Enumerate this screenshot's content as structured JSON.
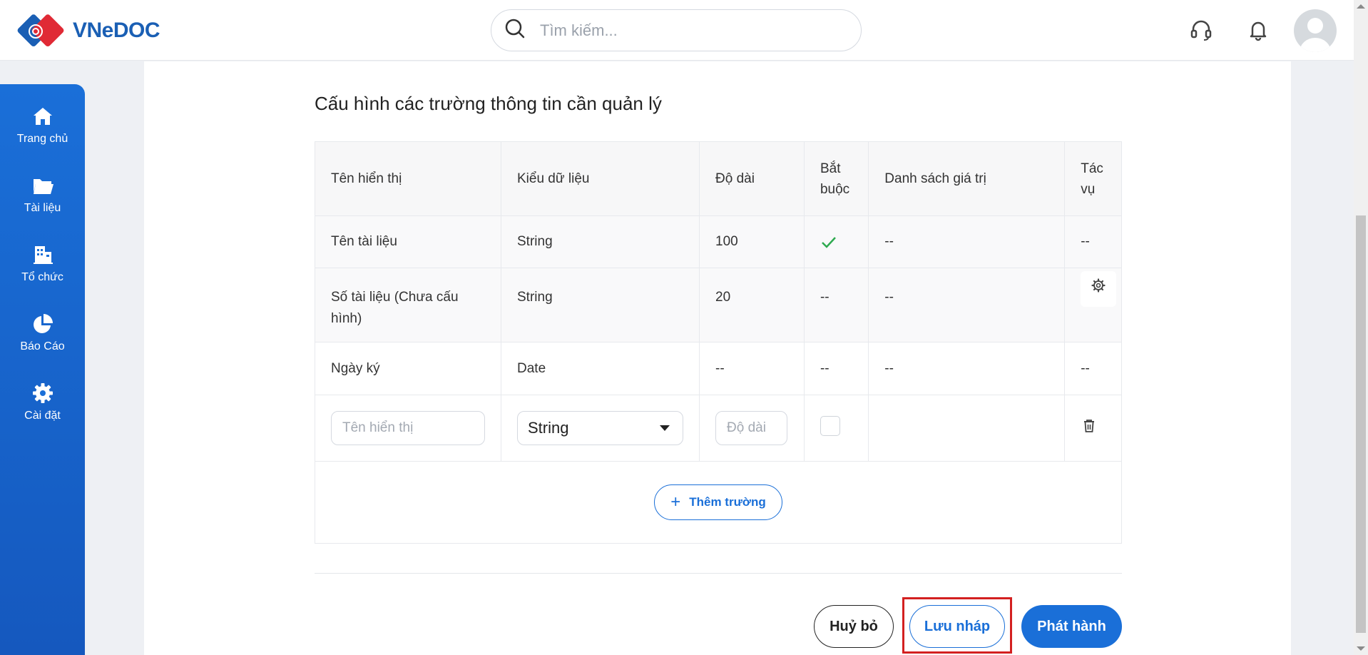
{
  "header": {
    "logo_text": "VNeDOC",
    "search_placeholder": "Tìm kiếm..."
  },
  "sidebar": {
    "items": [
      {
        "label": "Trang chủ",
        "icon": "home-icon"
      },
      {
        "label": "Tài liệu",
        "icon": "folder-icon"
      },
      {
        "label": "Tổ chức",
        "icon": "building-icon"
      },
      {
        "label": "Báo Cáo",
        "icon": "pie-chart-icon"
      },
      {
        "label": "Cài đặt",
        "icon": "gear-icon"
      }
    ]
  },
  "main": {
    "title": "Cấu hình các trường thông tin cần quản lý",
    "columns": [
      "Tên hiển thị",
      "Kiểu dữ liệu",
      "Độ dài",
      "Bắt buộc",
      "Danh sách giá trị",
      "Tác vụ"
    ],
    "rows": [
      {
        "name": "Tên tài liệu",
        "type": "String",
        "length": "100",
        "required": "check-icon",
        "values": "--",
        "action": "--"
      },
      {
        "name": "Số tài liệu (Chưa cấu hình)",
        "type": "String",
        "length": "20",
        "required": "--",
        "values": "--",
        "action": "gear-icon"
      },
      {
        "name": "Ngày ký",
        "type": "Date",
        "length": "--",
        "required": "--",
        "values": "--",
        "action": "--"
      }
    ],
    "new_row": {
      "name_placeholder": "Tên hiển thị",
      "type_value": "String",
      "length_placeholder": "Độ dài",
      "required_checked": false,
      "action_icon": "trash-icon"
    },
    "add_field_label": "Thêm trường"
  },
  "footer": {
    "cancel_label": "Huỷ bỏ",
    "draft_label": "Lưu nháp",
    "publish_label": "Phát hành"
  },
  "colors": {
    "primary": "#1a6fd8",
    "highlight": "#d32020",
    "check": "#2eaa4f"
  }
}
